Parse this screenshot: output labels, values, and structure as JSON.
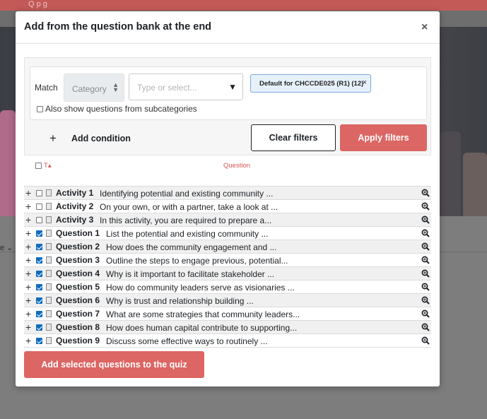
{
  "background": {
    "top_text": "Q      p       g"
  },
  "modal": {
    "title": "Add from the question bank at the end",
    "close_glyph": "×"
  },
  "filters": {
    "match_label": "Match",
    "category_select": "Category",
    "type_placeholder": "Type or select...",
    "tag_label": "Default for CHCCDE025 (R1) (12)",
    "tag_remove": "×",
    "subcategories_label": "Also show questions from subcategories",
    "add_condition_label": "Add condition",
    "clear_label": "Clear filters",
    "apply_label": "Apply filters"
  },
  "table": {
    "col_type": "T",
    "col_sort_glyph": "▴",
    "col_question": "Question",
    "rows": [
      {
        "name": "Activity 1",
        "text": "Identifying potential and existing community ...",
        "checked": false
      },
      {
        "name": "Activity 2",
        "text": "On your own, or with a partner, take a look at ...",
        "checked": false
      },
      {
        "name": "Activity 3",
        "text": "In this activity, you are required to prepare a...",
        "checked": false
      },
      {
        "name": "Question 1",
        "text": "List the potential and existing community ...",
        "checked": true
      },
      {
        "name": "Question 2",
        "text": "How does the community engagement and ...",
        "checked": true
      },
      {
        "name": "Question 3",
        "text": "Outline the steps to engage previous, potential...",
        "checked": true
      },
      {
        "name": "Question 4",
        "text": "Why is it important to facilitate stakeholder ...",
        "checked": true
      },
      {
        "name": "Question 5",
        "text": "How do community leaders serve as visionaries ...",
        "checked": true
      },
      {
        "name": "Question 6",
        "text": "Why is trust and relationship building ...",
        "checked": true
      },
      {
        "name": "Question 7",
        "text": "What are some strategies that community leaders...",
        "checked": true
      },
      {
        "name": "Question 8",
        "text": "How does human capital contribute to supporting...",
        "checked": true
      },
      {
        "name": "Question 9",
        "text": "Discuss some effective ways to routinely ...",
        "checked": true
      }
    ]
  },
  "add_selected_label": "Add selected questions to the quiz",
  "colors": {
    "accent": "#dc6663",
    "checkbox_checked": "#0f6cbf",
    "sort_header": "#d9534f"
  }
}
